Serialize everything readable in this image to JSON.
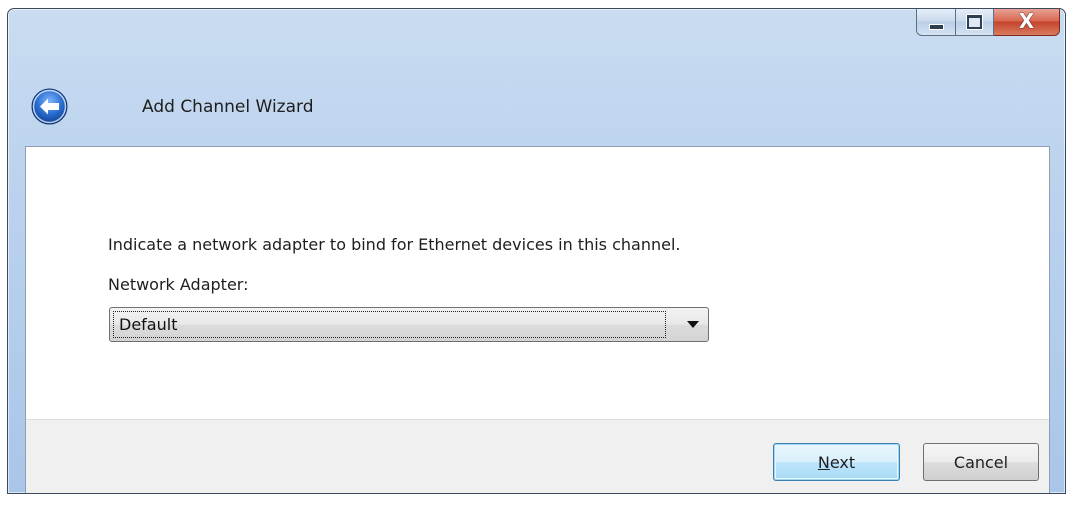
{
  "window": {
    "title": "Add Channel Wizard",
    "close_glyph": "X",
    "icons": {
      "back": "back-arrow-icon",
      "minimize": "minimize-icon",
      "maximize": "maximize-icon",
      "close": "close-icon",
      "dropdown": "chevron-down-icon"
    }
  },
  "main": {
    "instruction": "Indicate a network adapter to bind for Ethernet devices in this channel.",
    "adapter_label": "Network Adapter:",
    "adapter_select": {
      "value": "Default"
    }
  },
  "footer": {
    "next": {
      "mnemonic": "N",
      "rest": "ext"
    },
    "cancel_label": "Cancel"
  },
  "colors": {
    "titlebar": "#bcd3ee",
    "close_button": "#c2442b",
    "back_button": "#1f63c4",
    "default_button_border": "#3c7fb1",
    "footer_bg": "#f0f0f0"
  }
}
